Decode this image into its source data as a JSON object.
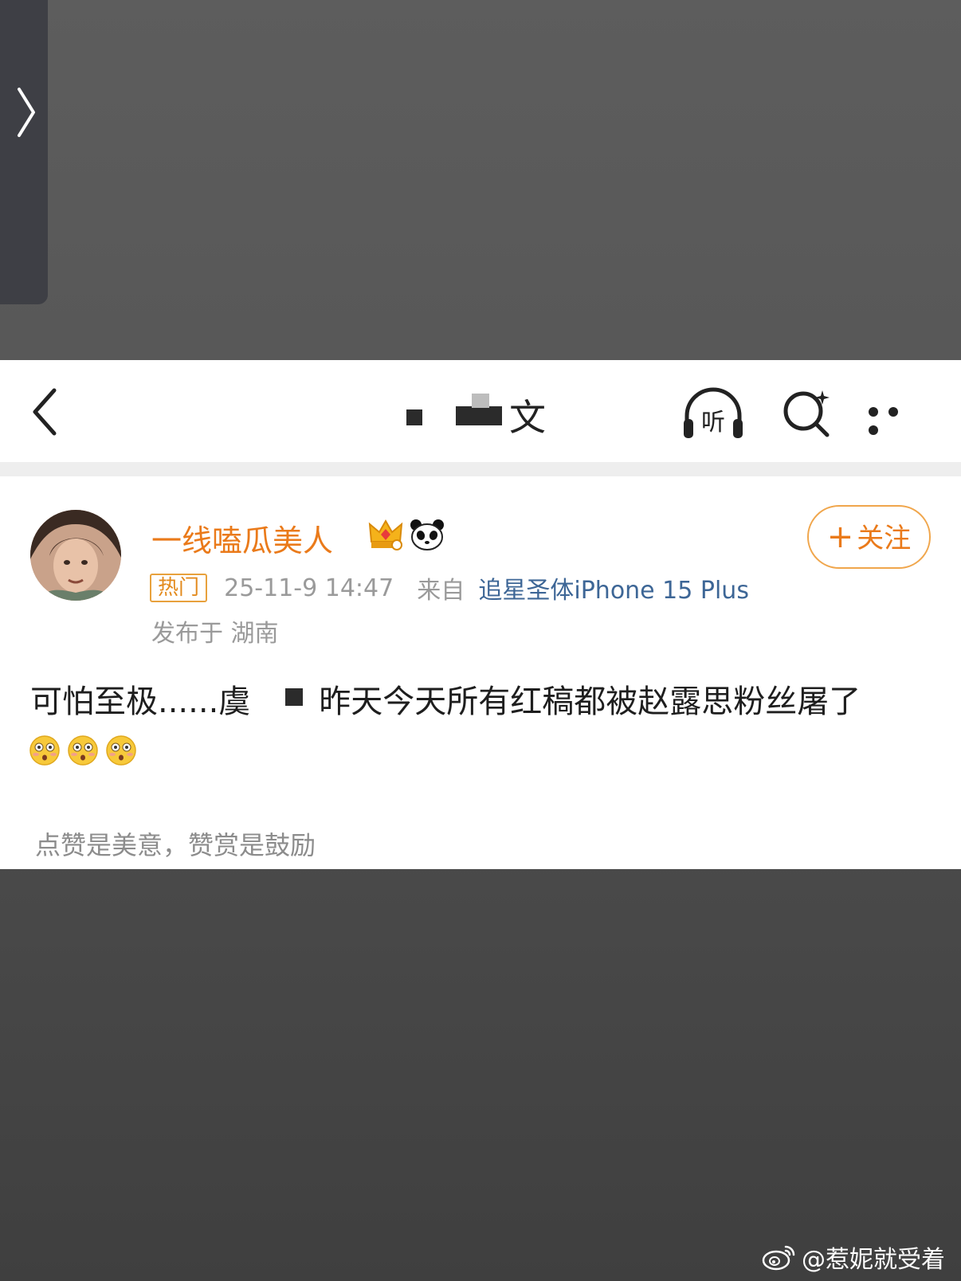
{
  "nav": {
    "title_visible": "文"
  },
  "post": {
    "username": "一线嗑瓜美人",
    "follow_label": "关注",
    "hot_badge": "热门",
    "time": "25-11-9 14:47",
    "from_label": "来自",
    "device": "追星圣体iPhone 15 Plus",
    "location": "发布于 湖南",
    "text_part1": "可怕至极......虞",
    "text_part2": "昨天今天所有红稿都被赵露思粉丝屠了",
    "emoji_count_label": "😳😳😳"
  },
  "footer": {
    "note": "点赞是美意，赞赏是鼓励"
  },
  "watermark": {
    "text": "@惹妮就受着"
  },
  "colors": {
    "accent_orange": "#ea7a1a",
    "link_blue": "#3d6696",
    "background_dark": "#585858"
  },
  "icons": [
    "chevron-right-icon",
    "back-icon",
    "listen-icon",
    "ai-search-icon",
    "more-icon",
    "crown-icon",
    "panda-icon",
    "flushed-emoji-icon",
    "weibo-logo-icon"
  ]
}
